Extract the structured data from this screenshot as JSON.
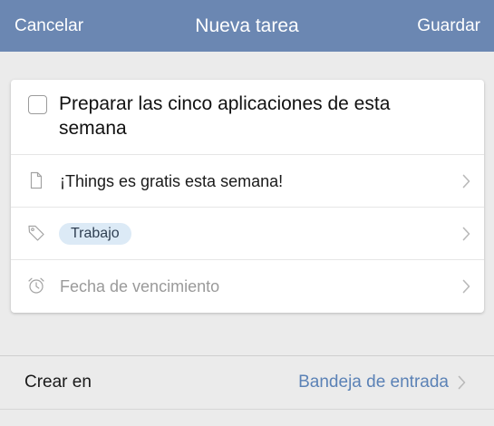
{
  "navbar": {
    "cancel_label": "Cancelar",
    "title": "Nueva tarea",
    "save_label": "Guardar",
    "color": "#6b87b2"
  },
  "task": {
    "title": "Preparar las cinco aplicaciones de esta semana",
    "completed": false,
    "notes": "¡Things es gratis esta semana!",
    "tags": [
      "Trabajo"
    ],
    "due_date_placeholder": "Fecha de vencimiento"
  },
  "icons": {
    "notes": "document-icon",
    "tags": "tag-icon",
    "due_date": "alarm-clock-icon",
    "disclosure": "chevron-right-icon"
  },
  "create_in": {
    "label": "Crear en",
    "value": "Bandeja de entrada",
    "value_color": "#5b82b6"
  }
}
